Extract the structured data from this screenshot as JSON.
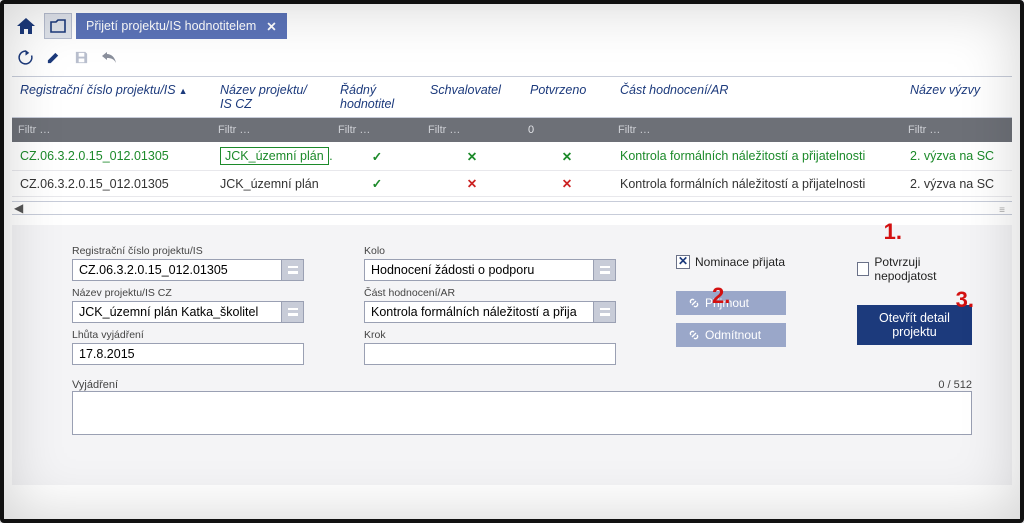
{
  "tab": {
    "title": "Přijetí projektu/IS hodnotitelem"
  },
  "columns": {
    "reg": "Registrační číslo projektu/IS",
    "nazev": "Název projektu/\nIS CZ",
    "radny": "Řádný\nhodnotitel",
    "schval": "Schvalovatel",
    "potvrzeno": "Potvrzeno",
    "cast": "Část hodnocení/AR",
    "vyzva": "Název výzvy"
  },
  "filter_placeholder": "Filtr …",
  "rows": [
    {
      "reg": "CZ.06.3.2.0.15_012.01305",
      "nazev": "JCK_územní plán",
      "radny": "✓",
      "schval": "✕",
      "potvrzeno": "✕",
      "cast": "Kontrola formálních náležitostí a přijatelnosti",
      "vyzva": "2. výzva na SC",
      "selected": true
    },
    {
      "reg": "CZ.06.3.2.0.15_012.01305",
      "nazev": "JCK_územní plán",
      "radny": "✓",
      "schval": "✕",
      "potvrzeno": "✕",
      "cast": "Kontrola formálních náležitostí a přijatelnosti",
      "vyzva": "2. výzva na SC",
      "selected": false
    }
  ],
  "detail": {
    "labels": {
      "reg": "Registrační číslo projektu/IS",
      "nazev": "Název projektu/IS CZ",
      "lhuta": "Lhůta vyjádření",
      "kolo": "Kolo",
      "cast": "Část hodnocení/AR",
      "krok": "Krok",
      "vyjadreni": "Vyjádření"
    },
    "values": {
      "reg": "CZ.06.3.2.0.15_012.01305",
      "nazev": "JCK_územní plán Katka_školitel",
      "lhuta": "17.8.2015",
      "kolo": "Hodnocení žádosti o podporu",
      "cast": "Kontrola formálních náležitostí a přija",
      "krok": ""
    },
    "checks": {
      "nominace": "Nominace přijata",
      "potvrzuji": "Potvrzuji nepodjatost"
    },
    "buttons": {
      "prijmout": "Přijmout",
      "odmitnout": "Odmítnout",
      "otevrit": "Otevřít detail projektu"
    },
    "counter": "0 / 512"
  },
  "annot": {
    "a1": "1.",
    "a2": "2.",
    "a3": "3."
  }
}
